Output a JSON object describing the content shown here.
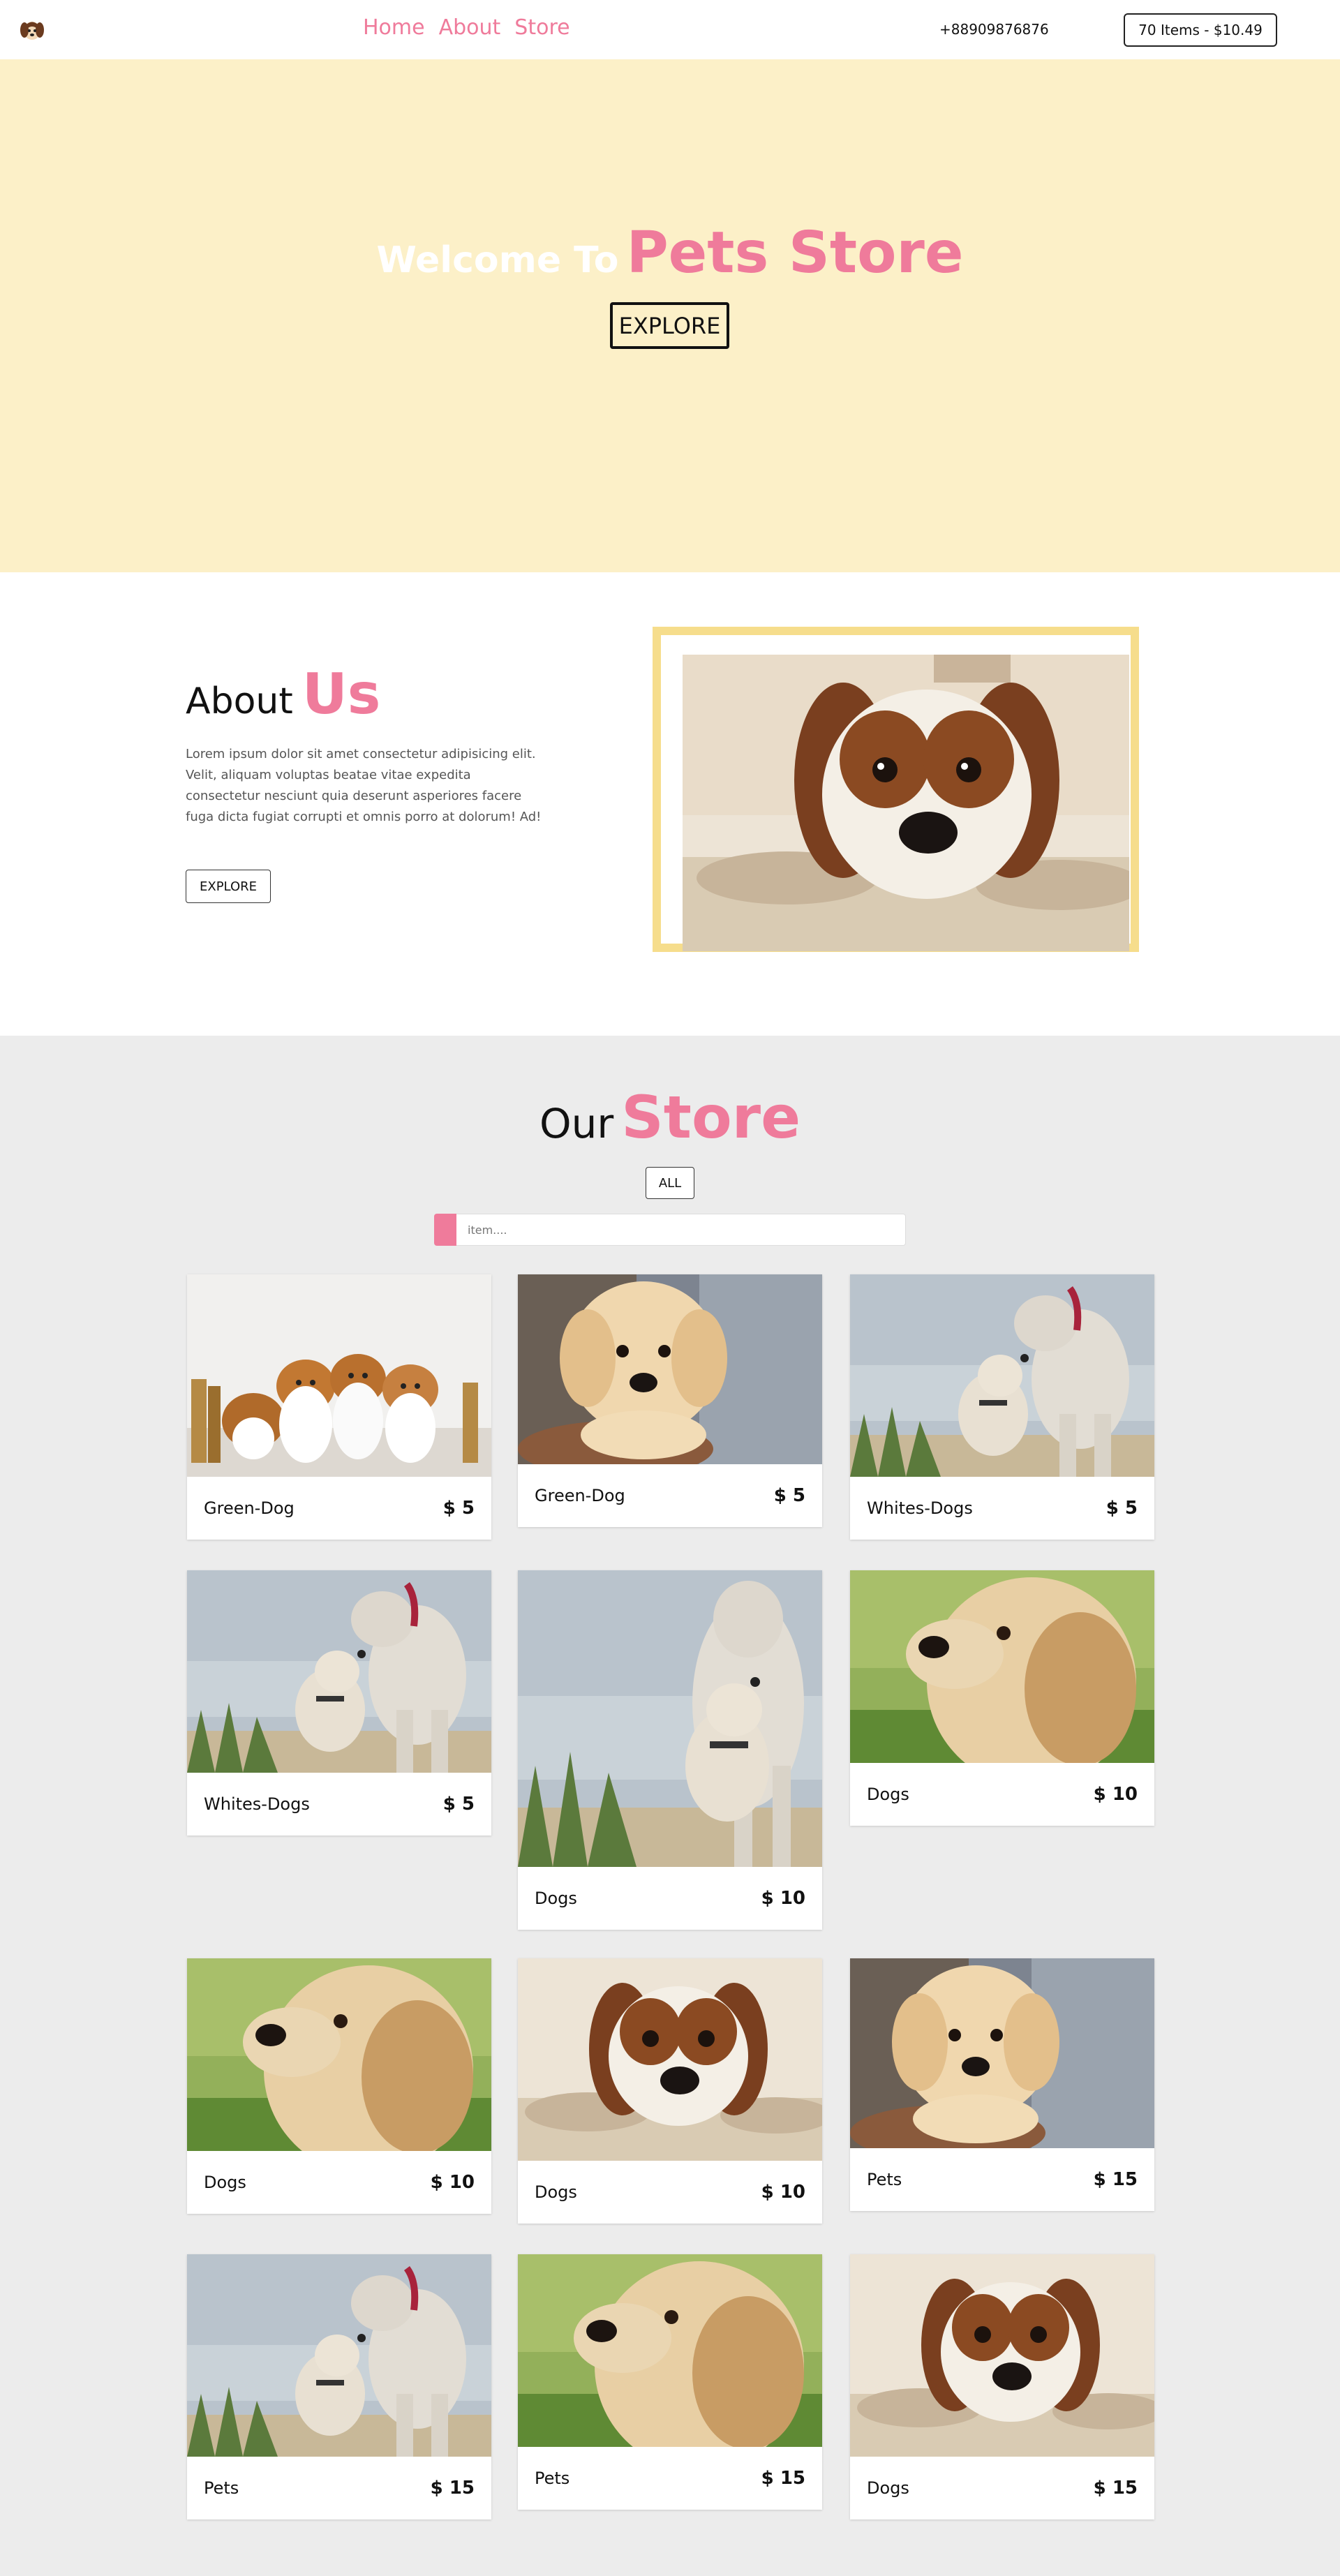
{
  "nav": {
    "links": [
      "Home",
      "About",
      "Store"
    ],
    "phone": "+88909876876",
    "cart": "70 Items - $10.49",
    "logo_icon": "puppy-logo-icon"
  },
  "hero": {
    "welcome": "Welcome To",
    "brand": "Pets  Store",
    "button": "EXPLORE"
  },
  "about": {
    "heading_1": "About",
    "heading_2": "Us",
    "text": "Lorem ipsum dolor sit amet consectetur adipisicing elit. Velit, aliquam voluptas beatae vitae expedita consectetur nesciunt quia deserunt asperiores facere fuga dicta fugiat corrupti et omnis porro at dolorum! Ad!",
    "button": "EXPLORE"
  },
  "store": {
    "heading_1": "Our",
    "heading_2": "Store",
    "filter_button": "ALL",
    "search_placeholder": "item....",
    "items": [
      {
        "name": "Green-Dog",
        "price": "$ 5",
        "photo": "corgi-puppies-photo"
      },
      {
        "name": "Green-Dog",
        "price": "$ 5",
        "photo": "lab-puppy-photo"
      },
      {
        "name": "Whites-Dogs",
        "price": "$ 5",
        "photo": "dogs-kissing-photo"
      },
      {
        "name": "Whites-Dogs",
        "price": "$ 5",
        "photo": "dogs-kissing-photo"
      },
      {
        "name": "Dogs",
        "price": "$ 10",
        "photo": "dogs-kissing-photo"
      },
      {
        "name": "Dogs",
        "price": "$ 10",
        "photo": "golden-puppy-photo"
      },
      {
        "name": "Dogs",
        "price": "$ 10",
        "photo": "golden-puppy-photo"
      },
      {
        "name": "Dogs",
        "price": "$ 10",
        "photo": "spaniel-photo"
      },
      {
        "name": "Pets",
        "price": "$ 15",
        "photo": "lab-puppy-photo"
      },
      {
        "name": "Pets",
        "price": "$ 15",
        "photo": "dogs-kissing-photo"
      },
      {
        "name": "Pets",
        "price": "$ 15",
        "photo": "golden-puppy-photo"
      },
      {
        "name": "Dogs",
        "price": "$ 15",
        "photo": "spaniel-photo"
      }
    ]
  },
  "colors": {
    "accent": "#ef7b9b",
    "hero_bg": "#fcf0c8",
    "frame": "#f6dd8c",
    "store_bg": "#ececec"
  }
}
